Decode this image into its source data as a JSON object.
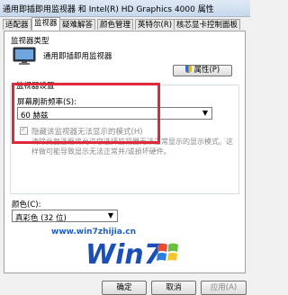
{
  "window": {
    "title": "通用即插即用监视器 和 Intel(R) HD Graphics 4000 属性"
  },
  "tabs": [
    "适配器",
    "监视器",
    "疑难解答",
    "颜色管理",
    "英特尔(R)",
    "核芯显卡控制面板"
  ],
  "active_tab_index": 1,
  "monitor_type": {
    "group_label": "监视器类型",
    "name": "通用即插即用监视器",
    "properties_button": "属性(P)"
  },
  "monitor_settings": {
    "group_label": "监视器设置",
    "refresh_label": "屏幕刷新频率(S):",
    "refresh_value": "60 赫兹",
    "hide_modes_label": "隐藏该监视器无法显示的模式(H)",
    "hide_modes_checked": true,
    "note": "清除此复选框将允许您选择监视器无法正常显示的显示模式。这样做可能导致显示无法正常并/或损坏硬件。"
  },
  "colors": {
    "label": "颜色(C):",
    "value": "真彩色 (32 位)"
  },
  "watermark": {
    "url": "www.win7zhijia.cn"
  },
  "buttons": {
    "ok": "确定",
    "cancel": "取消",
    "apply": "应用(A)"
  }
}
